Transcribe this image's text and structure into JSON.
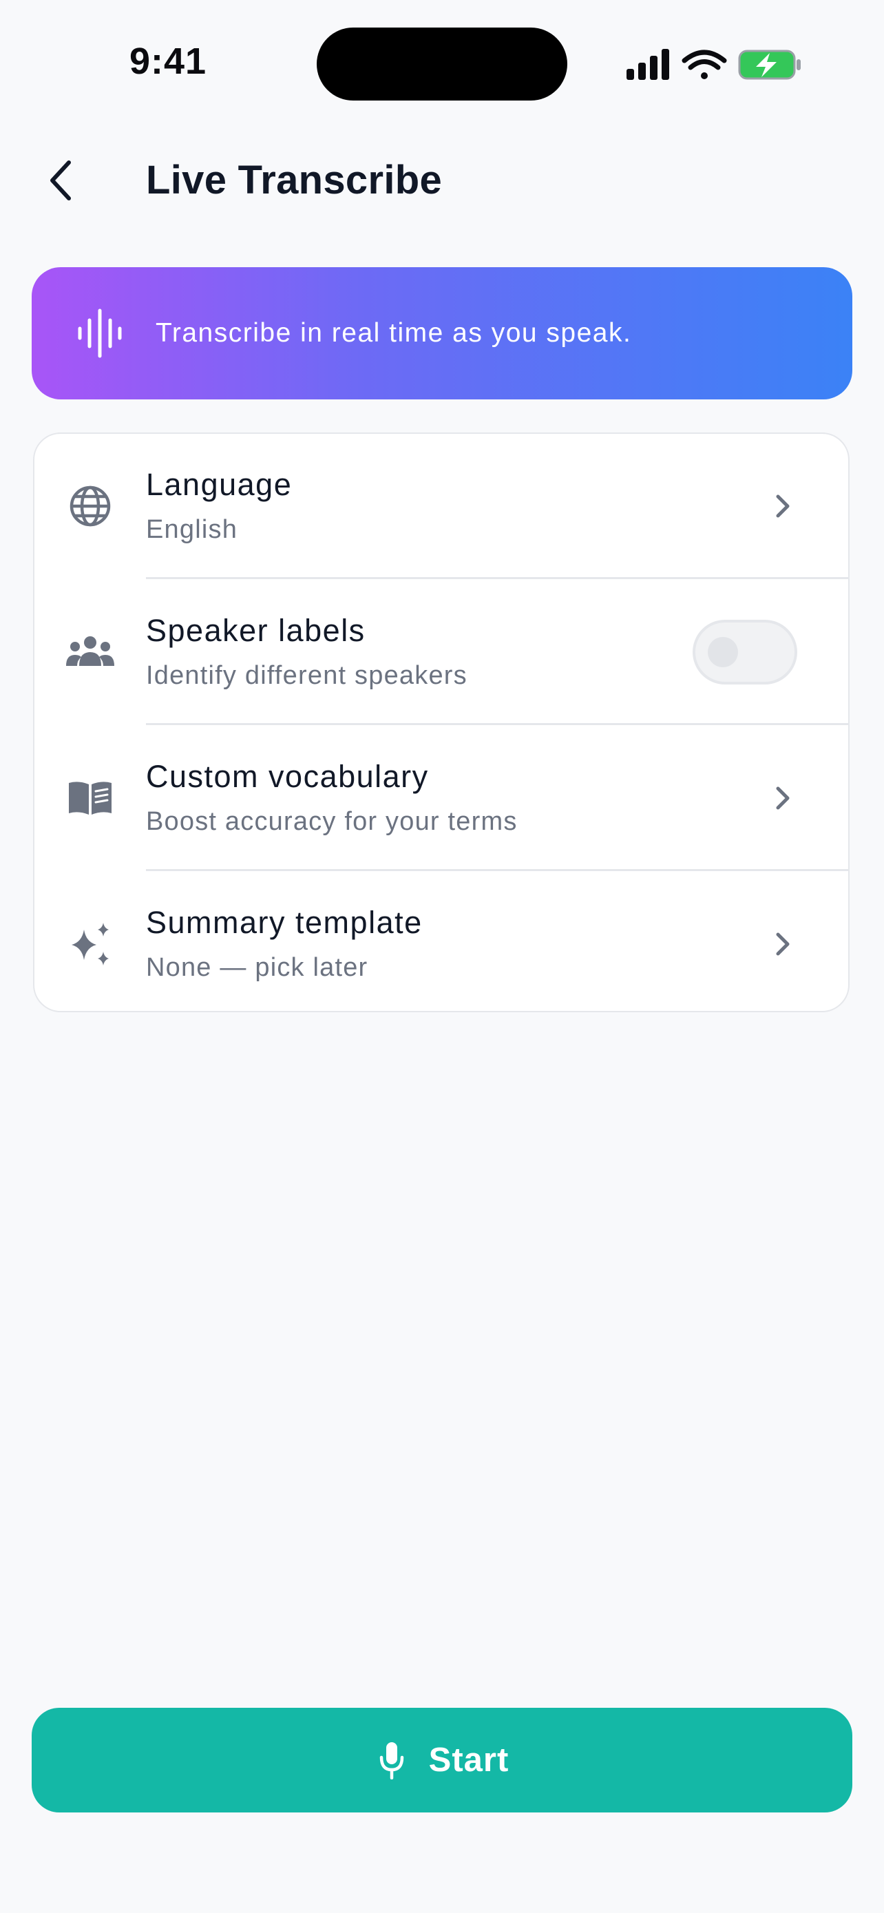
{
  "status_bar": {
    "time": "9:41"
  },
  "header": {
    "title": "Live Transcribe"
  },
  "banner": {
    "text": "Transcribe in real time as you speak.",
    "icon": "waveform-icon",
    "gradient_start": "#a855f7",
    "gradient_end": "#3b82f6"
  },
  "settings": {
    "items": [
      {
        "title": "Language",
        "subtitle": "English",
        "icon": "globe-icon",
        "control": "chevron"
      },
      {
        "title": "Speaker labels",
        "subtitle": "Identify different speakers",
        "icon": "people-icon",
        "control": "toggle",
        "toggle_on": false
      },
      {
        "title": "Custom vocabulary",
        "subtitle": "Boost accuracy for your terms",
        "icon": "book-icon",
        "control": "chevron"
      },
      {
        "title": "Summary template",
        "subtitle": "None — pick later",
        "icon": "sparkles-icon",
        "control": "chevron"
      }
    ]
  },
  "start_button": {
    "label": "Start",
    "icon": "microphone-icon",
    "color": "#14b8a6"
  }
}
